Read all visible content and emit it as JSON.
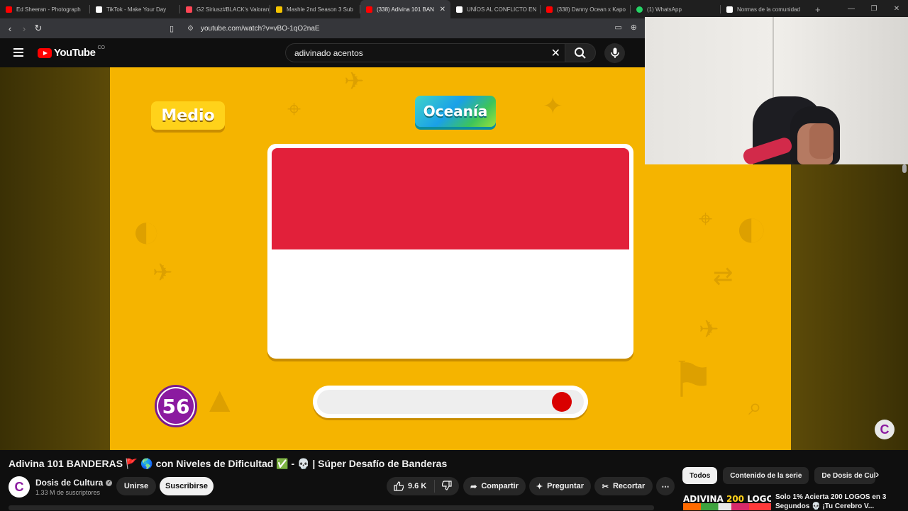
{
  "browser": {
    "tabs": [
      {
        "label": "Ed Sheeran - Photograph",
        "color": "#ff0000"
      },
      {
        "label": "TikTok - Make Your Day",
        "color": "#ffffff"
      },
      {
        "label": "G2 Siriusz#BLACK's Valorant",
        "color": "#ff4655"
      },
      {
        "label": "Mashle 2nd Season 3 Sub",
        "color": "#f5c400"
      },
      {
        "label": "(338) Adivina 101 BAN",
        "color": "#ff0000"
      },
      {
        "label": "UNÍOS AL CONFLICTO EN",
        "color": "#ffffff"
      },
      {
        "label": "(338) Danny Ocean x Kapo",
        "color": "#ff0000"
      },
      {
        "label": "(1) WhatsApp",
        "color": "#25d366"
      },
      {
        "label": "Normas de la comunidad",
        "color": "#ffffff"
      }
    ],
    "active_tab": 4,
    "url": "youtube.com/watch?v=vBO-1qO2naE"
  },
  "youtube": {
    "logo_text": "YouTube",
    "country_code": "CO",
    "search_value": "adivinado acentos"
  },
  "video": {
    "difficulty_label": "Medio",
    "region_label": "Oceanía",
    "flag_colors": [
      "#e2203a",
      "#ffffff"
    ],
    "counter": "56",
    "timer_fraction": 0.95,
    "watermark": "C"
  },
  "details": {
    "title": "Adivina 101 BANDERAS 🚩 🌎 con Niveles de Dificultad ✅ - 💀 | Súper Desafío de Banderas",
    "channel_name": "Dosis de Cultura",
    "subscribers": "1.33 M de suscriptores",
    "join_label": "Unirse",
    "subscribe_label": "Suscribirse",
    "likes": "9.6 K",
    "share_label": "Compartir",
    "ask_label": "Preguntar",
    "clip_label": "Recortar",
    "more_label": "⋯"
  },
  "sidebar": {
    "chips": [
      "Todos",
      "Contenido de la serie",
      "De Dosis de Cul"
    ],
    "rec_thumb_text": "ADIVINA",
    "rec_thumb_number": "200",
    "rec_thumb_text2": "LOGOS",
    "rec_title": "Solo 1% Acierta 200 LOGOS en 3 Segundos 💀 ¡Tu Cerebro V..."
  }
}
